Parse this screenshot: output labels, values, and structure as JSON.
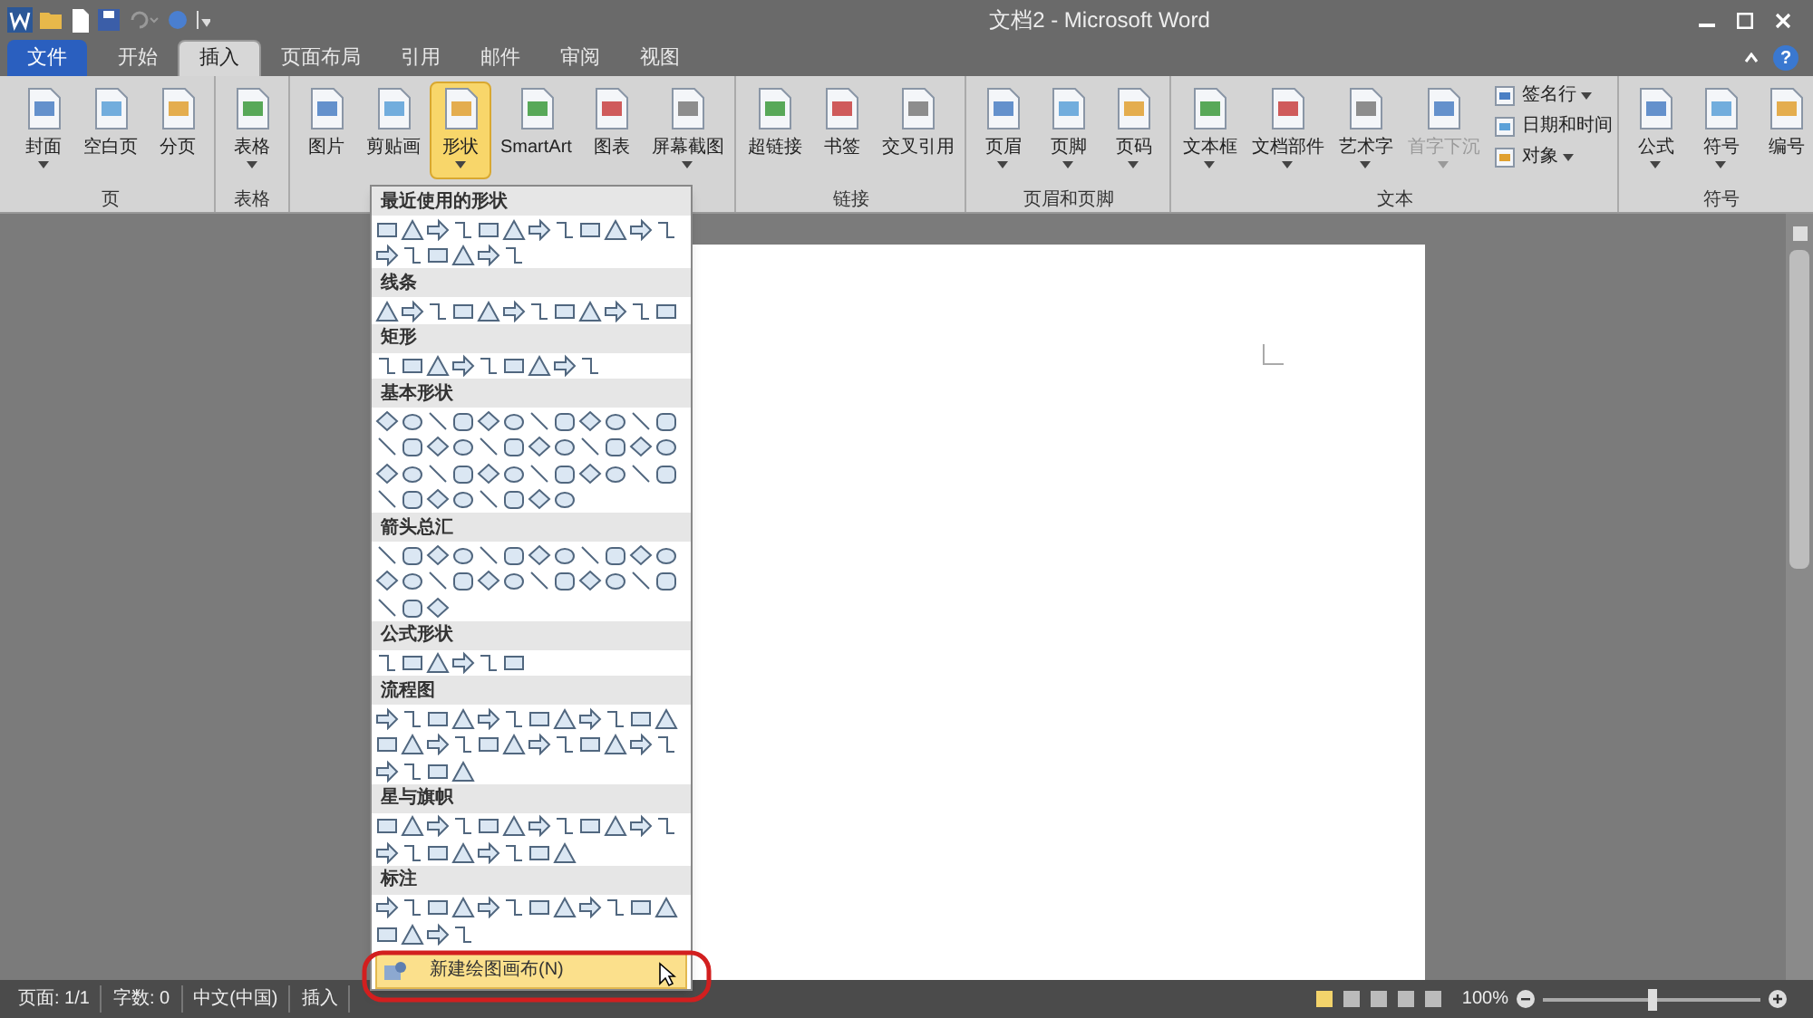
{
  "window": {
    "title": "文档2 - Microsoft Word",
    "help": "?"
  },
  "tabs": [
    {
      "label": "文件",
      "kind": "file",
      "selected": false
    },
    {
      "label": "开始",
      "kind": "tab",
      "selected": false
    },
    {
      "label": "插入",
      "kind": "tab",
      "selected": true
    },
    {
      "label": "页面布局",
      "kind": "tab",
      "selected": false
    },
    {
      "label": "引用",
      "kind": "tab",
      "selected": false
    },
    {
      "label": "邮件",
      "kind": "tab",
      "selected": false
    },
    {
      "label": "审阅",
      "kind": "tab",
      "selected": false
    },
    {
      "label": "视图",
      "kind": "tab",
      "selected": false
    }
  ],
  "ribbon_groups": [
    {
      "label": "页",
      "buttons": [
        {
          "label": "封面",
          "dropdown": true,
          "selected": false,
          "disabled": false
        },
        {
          "label": "空白页",
          "dropdown": false,
          "selected": false,
          "disabled": false
        },
        {
          "label": "分页",
          "dropdown": false,
          "selected": false,
          "disabled": false
        }
      ]
    },
    {
      "label": "表格",
      "buttons": [
        {
          "label": "表格",
          "dropdown": true,
          "selected": false,
          "disabled": false
        }
      ]
    },
    {
      "buttons": [
        {
          "label": "图片",
          "dropdown": false,
          "selected": false,
          "disabled": false
        },
        {
          "label": "剪贴画",
          "dropdown": false,
          "selected": false,
          "disabled": false
        },
        {
          "label": "形状",
          "dropdown": true,
          "selected": true,
          "disabled": false
        },
        {
          "label": "SmartArt",
          "dropdown": false,
          "selected": false,
          "disabled": false
        },
        {
          "label": "图表",
          "dropdown": false,
          "selected": false,
          "disabled": false
        },
        {
          "label": "屏幕截图",
          "dropdown": true,
          "selected": false,
          "disabled": false
        }
      ]
    },
    {
      "label": "链接",
      "buttons": [
        {
          "label": "超链接",
          "dropdown": false,
          "selected": false,
          "disabled": false
        },
        {
          "label": "书签",
          "dropdown": false,
          "selected": false,
          "disabled": false
        },
        {
          "label": "交叉引用",
          "dropdown": false,
          "selected": false,
          "disabled": false
        }
      ]
    },
    {
      "label": "页眉和页脚",
      "buttons": [
        {
          "label": "页眉",
          "dropdown": true,
          "selected": false,
          "disabled": false
        },
        {
          "label": "页脚",
          "dropdown": true,
          "selected": false,
          "disabled": false
        },
        {
          "label": "页码",
          "dropdown": true,
          "selected": false,
          "disabled": false
        }
      ]
    },
    {
      "label": "文本",
      "buttons": [
        {
          "label": "文本框",
          "dropdown": true,
          "selected": false,
          "disabled": false
        },
        {
          "label": "文档部件",
          "dropdown": true,
          "selected": false,
          "disabled": false
        },
        {
          "label": "艺术字",
          "dropdown": true,
          "selected": false,
          "disabled": false
        },
        {
          "label": "首字下沉",
          "dropdown": true,
          "selected": false,
          "disabled": true
        }
      ],
      "small_buttons": [
        {
          "label": "签名行",
          "dropdown": true
        },
        {
          "label": "日期和时间",
          "dropdown": false
        },
        {
          "label": "对象",
          "dropdown": true
        }
      ]
    },
    {
      "label": "符号",
      "buttons": [
        {
          "label": "公式",
          "dropdown": true,
          "selected": false,
          "disabled": false
        },
        {
          "label": "符号",
          "dropdown": true,
          "selected": false,
          "disabled": false
        },
        {
          "label": "编号",
          "dropdown": false,
          "selected": false,
          "disabled": false
        }
      ]
    }
  ],
  "shapes_menu": {
    "sections": [
      {
        "title": "最近使用的形状"
      },
      {
        "title": "线条"
      },
      {
        "title": "矩形"
      },
      {
        "title": "基本形状"
      },
      {
        "title": "箭头总汇"
      },
      {
        "title": "公式形状"
      },
      {
        "title": "流程图"
      },
      {
        "title": "星与旗帜"
      },
      {
        "title": "标注"
      }
    ],
    "footer": {
      "label": "新建绘图画布(N)",
      "selected": true
    }
  },
  "status_bar": {
    "items": [
      "页面: 1/1",
      "字数: 0",
      "中文(中国)",
      "插入"
    ],
    "zoom": "100%",
    "zoom_slider": {
      "level": 0.5
    }
  }
}
